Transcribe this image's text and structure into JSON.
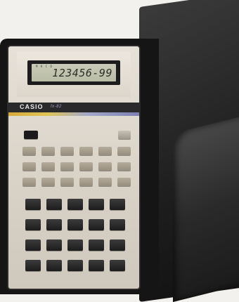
{
  "display": {
    "indicators": "M  K  C  D",
    "digits": "123456-99"
  },
  "calculator": {
    "brand": "CASIO",
    "model": "fx-82"
  },
  "colors": {
    "case": "#1e1e1e",
    "body": "#dcd6cb",
    "lcd": "#bfc2ad"
  },
  "keypad": {
    "rows_function": 3,
    "rows_main": 4,
    "cols": 5
  }
}
